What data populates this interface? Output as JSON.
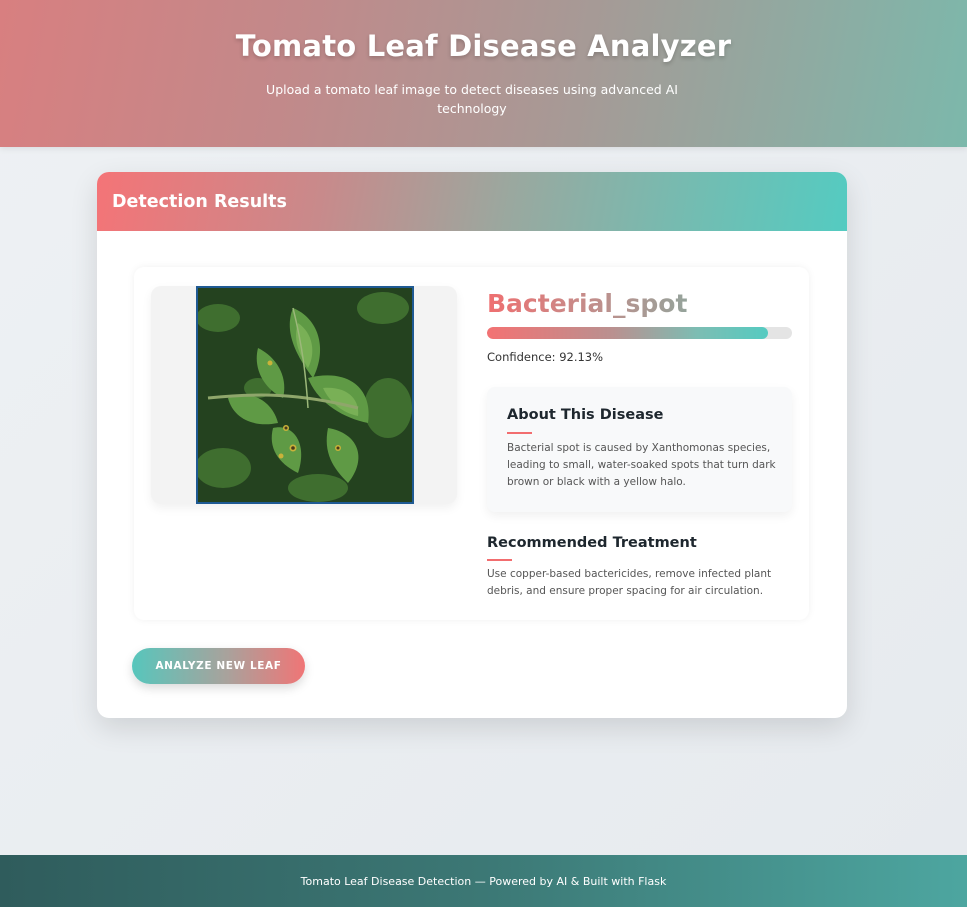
{
  "header": {
    "title": "Tomato Leaf Disease Analyzer",
    "subtitle": "Upload a tomato leaf image to detect diseases using advanced AI technology"
  },
  "card": {
    "title": "Detection Results"
  },
  "result": {
    "disease": "Bacterial_spot",
    "confidence_label": "Confidence: 92.13%",
    "confidence_percent": 92.13,
    "about_title": "About This Disease",
    "about_text": "Bacterial spot is caused by Xanthomonas species, leading to small, water-soaked spots that turn dark brown or black with a yellow halo.",
    "treatment_title": "Recommended Treatment",
    "treatment_text": "Use copper-based bactericides, remove infected plant debris, and ensure proper spacing for air circulation."
  },
  "actions": {
    "analyze_new": "ANALYZE NEW LEAF"
  },
  "footer": {
    "text": "Tomato Leaf Disease Detection — Powered by AI & Built with Flask"
  },
  "colors": {
    "accent_coral": "#f47477",
    "accent_teal": "#54cbc1",
    "footer_dark": "#2f5c5c"
  }
}
